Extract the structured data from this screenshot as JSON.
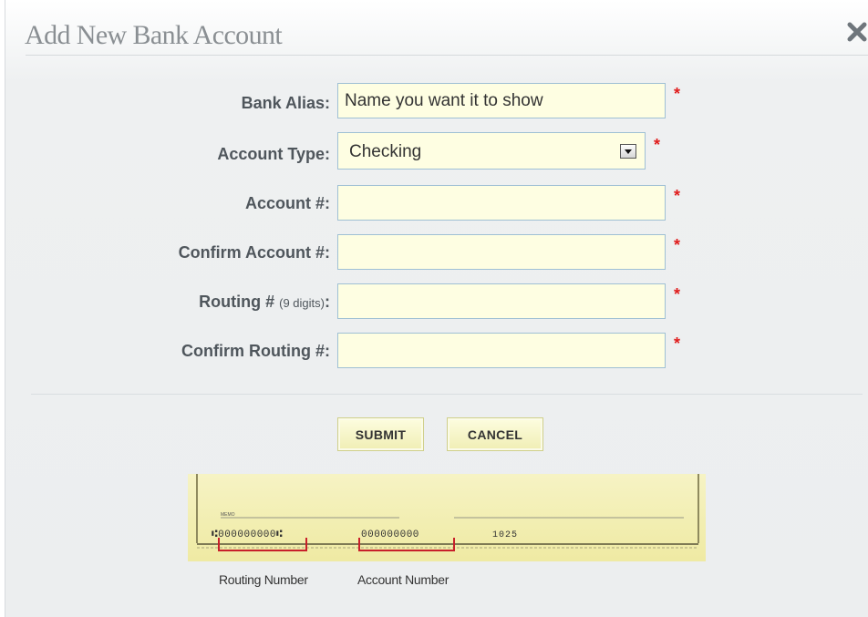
{
  "dialog": {
    "title": "Add New Bank Account",
    "close_icon": "close-x-icon"
  },
  "form": {
    "bank_alias": {
      "label": "Bank Alias:",
      "value": "Name you want it to show",
      "required": true
    },
    "account_type": {
      "label": "Account Type:",
      "value": "Checking",
      "required": true
    },
    "account_number": {
      "label": "Account #:",
      "value": "",
      "required": true
    },
    "confirm_account_number": {
      "label": "Confirm Account #:",
      "value": "",
      "required": true
    },
    "routing_number": {
      "label": "Routing #",
      "label_hint": "(9 digits)",
      "label_colon": ":",
      "value": "",
      "required": true
    },
    "confirm_routing_number": {
      "label": "Confirm Routing #:",
      "value": "",
      "required": true
    },
    "required_mark": "*"
  },
  "buttons": {
    "submit": "SUBMIT",
    "cancel": "CANCEL"
  },
  "check_example": {
    "memo_label": "MEMO",
    "routing_digits": "⑆000000000⑆",
    "account_digits": "000000000",
    "check_number": "1025",
    "routing_caption": "Routing Number",
    "account_caption": "Account Number"
  },
  "colors": {
    "input_bg": "#fefee2",
    "input_border": "#9fc0d4",
    "required_star": "#e01c1c",
    "label_text": "#4f565c",
    "title_text": "#8a8f93",
    "check_bg": "#f3efb0",
    "bracket": "#c8202a"
  }
}
